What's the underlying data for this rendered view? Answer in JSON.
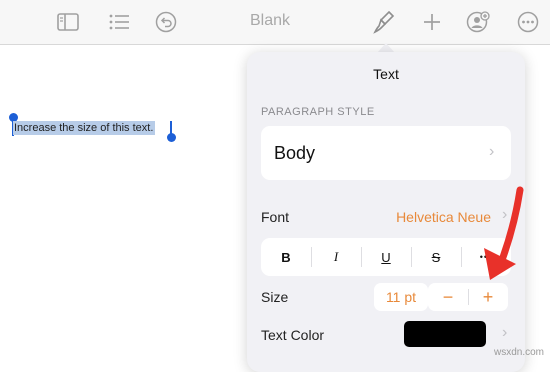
{
  "toolbar": {
    "title": "Blank",
    "icons": [
      "sidebar-icon",
      "list-icon",
      "undo-icon",
      "paintbrush-icon",
      "plus-icon",
      "add-collaborator-icon",
      "more-icon"
    ]
  },
  "document": {
    "selected_text": "Increase the size of this text."
  },
  "format_panel": {
    "title": "Text",
    "paragraph_style_label": "PARAGRAPH STYLE",
    "paragraph_style_value": "Body",
    "font_label": "Font",
    "font_value": "Helvetica Neue",
    "format_buttons": [
      "B",
      "I",
      "U",
      "S",
      "•••"
    ],
    "size_label": "Size",
    "size_value": "11 pt",
    "decrease_label": "−",
    "increase_label": "+",
    "text_color_label": "Text Color",
    "text_color": "#000000"
  },
  "accent_color": "#e8893a",
  "annotation_arrow_color": "#e8312a",
  "watermark": "wsxdn.com"
}
